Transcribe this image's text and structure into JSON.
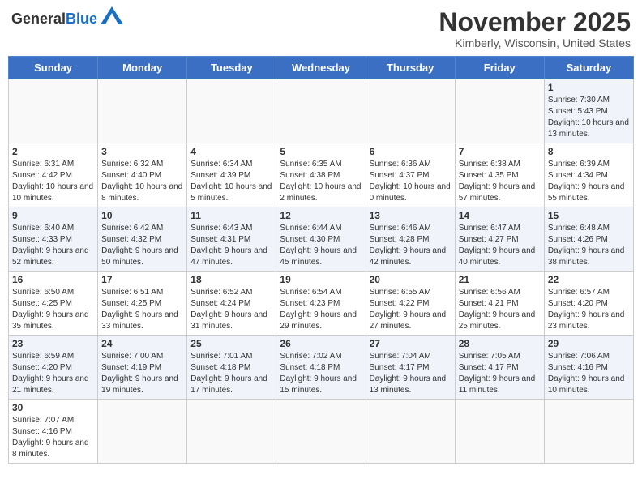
{
  "logo": {
    "general": "General",
    "blue": "Blue"
  },
  "header": {
    "month_title": "November 2025",
    "subtitle": "Kimberly, Wisconsin, United States"
  },
  "weekdays": [
    "Sunday",
    "Monday",
    "Tuesday",
    "Wednesday",
    "Thursday",
    "Friday",
    "Saturday"
  ],
  "weeks": [
    [
      {
        "day": "",
        "info": ""
      },
      {
        "day": "",
        "info": ""
      },
      {
        "day": "",
        "info": ""
      },
      {
        "day": "",
        "info": ""
      },
      {
        "day": "",
        "info": ""
      },
      {
        "day": "",
        "info": ""
      },
      {
        "day": "1",
        "info": "Sunrise: 7:30 AM\nSunset: 5:43 PM\nDaylight: 10 hours and 13 minutes."
      }
    ],
    [
      {
        "day": "2",
        "info": "Sunrise: 6:31 AM\nSunset: 4:42 PM\nDaylight: 10 hours and 10 minutes."
      },
      {
        "day": "3",
        "info": "Sunrise: 6:32 AM\nSunset: 4:40 PM\nDaylight: 10 hours and 8 minutes."
      },
      {
        "day": "4",
        "info": "Sunrise: 6:34 AM\nSunset: 4:39 PM\nDaylight: 10 hours and 5 minutes."
      },
      {
        "day": "5",
        "info": "Sunrise: 6:35 AM\nSunset: 4:38 PM\nDaylight: 10 hours and 2 minutes."
      },
      {
        "day": "6",
        "info": "Sunrise: 6:36 AM\nSunset: 4:37 PM\nDaylight: 10 hours and 0 minutes."
      },
      {
        "day": "7",
        "info": "Sunrise: 6:38 AM\nSunset: 4:35 PM\nDaylight: 9 hours and 57 minutes."
      },
      {
        "day": "8",
        "info": "Sunrise: 6:39 AM\nSunset: 4:34 PM\nDaylight: 9 hours and 55 minutes."
      }
    ],
    [
      {
        "day": "9",
        "info": "Sunrise: 6:40 AM\nSunset: 4:33 PM\nDaylight: 9 hours and 52 minutes."
      },
      {
        "day": "10",
        "info": "Sunrise: 6:42 AM\nSunset: 4:32 PM\nDaylight: 9 hours and 50 minutes."
      },
      {
        "day": "11",
        "info": "Sunrise: 6:43 AM\nSunset: 4:31 PM\nDaylight: 9 hours and 47 minutes."
      },
      {
        "day": "12",
        "info": "Sunrise: 6:44 AM\nSunset: 4:30 PM\nDaylight: 9 hours and 45 minutes."
      },
      {
        "day": "13",
        "info": "Sunrise: 6:46 AM\nSunset: 4:28 PM\nDaylight: 9 hours and 42 minutes."
      },
      {
        "day": "14",
        "info": "Sunrise: 6:47 AM\nSunset: 4:27 PM\nDaylight: 9 hours and 40 minutes."
      },
      {
        "day": "15",
        "info": "Sunrise: 6:48 AM\nSunset: 4:26 PM\nDaylight: 9 hours and 38 minutes."
      }
    ],
    [
      {
        "day": "16",
        "info": "Sunrise: 6:50 AM\nSunset: 4:25 PM\nDaylight: 9 hours and 35 minutes."
      },
      {
        "day": "17",
        "info": "Sunrise: 6:51 AM\nSunset: 4:25 PM\nDaylight: 9 hours and 33 minutes."
      },
      {
        "day": "18",
        "info": "Sunrise: 6:52 AM\nSunset: 4:24 PM\nDaylight: 9 hours and 31 minutes."
      },
      {
        "day": "19",
        "info": "Sunrise: 6:54 AM\nSunset: 4:23 PM\nDaylight: 9 hours and 29 minutes."
      },
      {
        "day": "20",
        "info": "Sunrise: 6:55 AM\nSunset: 4:22 PM\nDaylight: 9 hours and 27 minutes."
      },
      {
        "day": "21",
        "info": "Sunrise: 6:56 AM\nSunset: 4:21 PM\nDaylight: 9 hours and 25 minutes."
      },
      {
        "day": "22",
        "info": "Sunrise: 6:57 AM\nSunset: 4:20 PM\nDaylight: 9 hours and 23 minutes."
      }
    ],
    [
      {
        "day": "23",
        "info": "Sunrise: 6:59 AM\nSunset: 4:20 PM\nDaylight: 9 hours and 21 minutes."
      },
      {
        "day": "24",
        "info": "Sunrise: 7:00 AM\nSunset: 4:19 PM\nDaylight: 9 hours and 19 minutes."
      },
      {
        "day": "25",
        "info": "Sunrise: 7:01 AM\nSunset: 4:18 PM\nDaylight: 9 hours and 17 minutes."
      },
      {
        "day": "26",
        "info": "Sunrise: 7:02 AM\nSunset: 4:18 PM\nDaylight: 9 hours and 15 minutes."
      },
      {
        "day": "27",
        "info": "Sunrise: 7:04 AM\nSunset: 4:17 PM\nDaylight: 9 hours and 13 minutes."
      },
      {
        "day": "28",
        "info": "Sunrise: 7:05 AM\nSunset: 4:17 PM\nDaylight: 9 hours and 11 minutes."
      },
      {
        "day": "29",
        "info": "Sunrise: 7:06 AM\nSunset: 4:16 PM\nDaylight: 9 hours and 10 minutes."
      }
    ],
    [
      {
        "day": "30",
        "info": "Sunrise: 7:07 AM\nSunset: 4:16 PM\nDaylight: 9 hours and 8 minutes."
      },
      {
        "day": "",
        "info": ""
      },
      {
        "day": "",
        "info": ""
      },
      {
        "day": "",
        "info": ""
      },
      {
        "day": "",
        "info": ""
      },
      {
        "day": "",
        "info": ""
      },
      {
        "day": "",
        "info": ""
      }
    ]
  ]
}
